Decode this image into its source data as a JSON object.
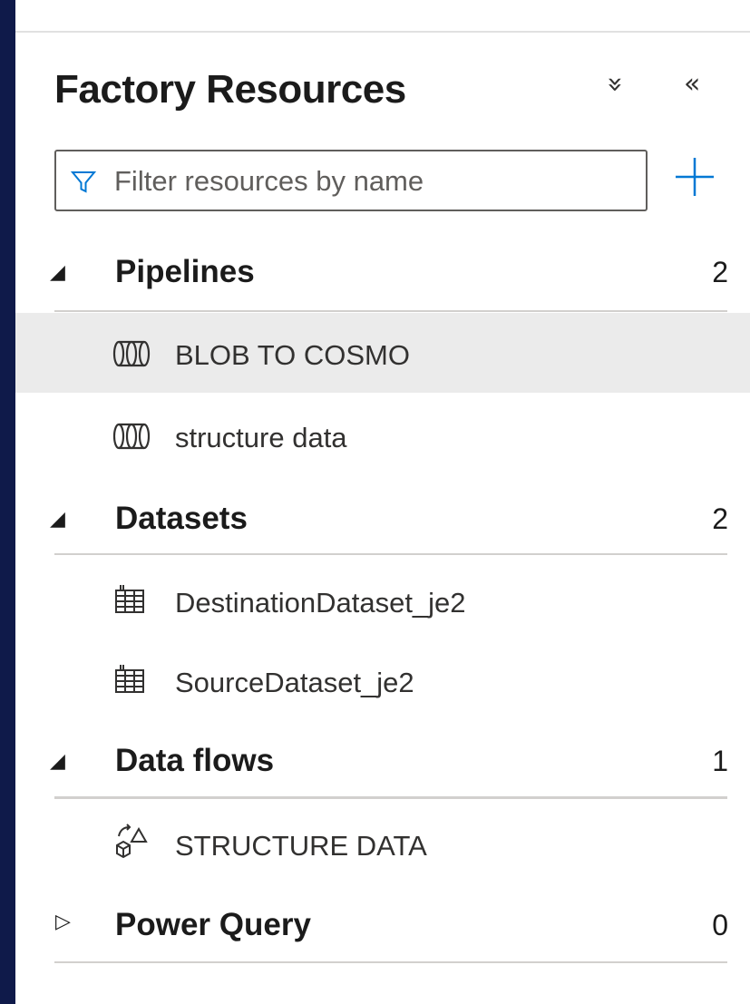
{
  "panel": {
    "title": "Factory Resources",
    "expand_all_icon": "»",
    "collapse_icon": "«"
  },
  "search": {
    "placeholder": "Filter resources by name",
    "value": ""
  },
  "sections": [
    {
      "name": "Pipelines",
      "count": "2",
      "expanded": true,
      "items": [
        {
          "label": "BLOB TO COSMO",
          "icon": "pipeline-icon",
          "selected": true
        },
        {
          "label": "structure data",
          "icon": "pipeline-icon",
          "selected": false
        }
      ]
    },
    {
      "name": "Datasets",
      "count": "2",
      "expanded": true,
      "items": [
        {
          "label": "DestinationDataset_je2",
          "icon": "dataset-table-icon"
        },
        {
          "label": "SourceDataset_je2",
          "icon": "dataset-table-icon"
        }
      ]
    },
    {
      "name": "Data flows",
      "count": "1",
      "expanded": true,
      "items": [
        {
          "label": "STRUCTURE DATA",
          "icon": "dataflow-icon"
        }
      ]
    },
    {
      "name": "Power Query",
      "count": "0",
      "expanded": false,
      "items": []
    }
  ],
  "colors": {
    "background": "#0f1a4a",
    "accent": "#0078d4",
    "selected_row": "#ebebeb"
  }
}
